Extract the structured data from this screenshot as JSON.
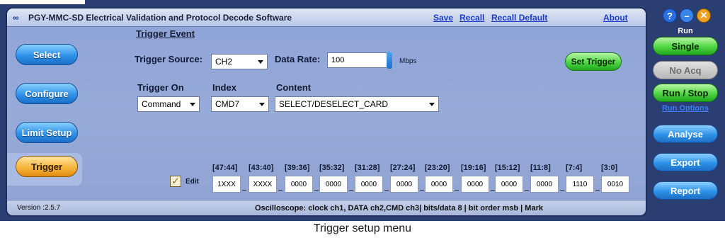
{
  "window": {
    "logo_glyph": "∞",
    "title": "PGY-MMC-SD Electrical Validation and Protocol Decode Software",
    "links": {
      "save": "Save",
      "recall": "Recall",
      "recall_default": "Recall Default",
      "about": "About"
    }
  },
  "nav": {
    "select": "Select",
    "configure": "Configure",
    "limit_setup": "Limit Setup",
    "trigger": "Trigger",
    "active": "Trigger"
  },
  "trigger": {
    "section_title": "Trigger Event",
    "source_label": "Trigger Source:",
    "source_value": "CH2",
    "data_rate_label": "Data Rate:",
    "data_rate_value": "100",
    "data_rate_unit": "Mbps",
    "set_trigger": "Set Trigger",
    "trigger_on_label": "Trigger On",
    "trigger_on_value": "Command",
    "index_label": "Index",
    "index_value": "CMD7",
    "content_label": "Content",
    "content_value": "SELECT/DESELECT_CARD",
    "edit_label": "Edit",
    "edit_checked": true,
    "check_glyph": "✓"
  },
  "bits": {
    "labels": [
      "[47:44]",
      "[43:40]",
      "[39:36]",
      "[35:32]",
      "[31:28]",
      "[27:24]",
      "[23:20]",
      "[19:16]",
      "[15:12]",
      "[11:8]",
      "[7:4]",
      "[3:0]"
    ],
    "values": [
      "1XXX",
      "XXXX",
      "0000",
      "0000",
      "0000",
      "0000",
      "0000",
      "0000",
      "0000",
      "0000",
      "1110",
      "0010"
    ]
  },
  "status": {
    "version": "Version :2.5.7",
    "text": "Oscilloscope: clock ch1, DATA ch2,CMD ch3| bits/data 8 | bit order msb | Mark"
  },
  "right": {
    "help_glyph": "?",
    "minimize_glyph": "–",
    "close_glyph": "✕",
    "run_label": "Run",
    "single": "Single",
    "no_acq": "No Acq",
    "run_stop": "Run / Stop",
    "run_options": "Run Options",
    "analyse": "Analyse",
    "export": "Export",
    "report": "Report"
  },
  "caption": "Trigger setup menu",
  "colors": {
    "accent_blue": "#2f92e8",
    "accent_green": "#4fd645",
    "active_orange": "#f7b53d",
    "frame": "#2b3e72"
  }
}
